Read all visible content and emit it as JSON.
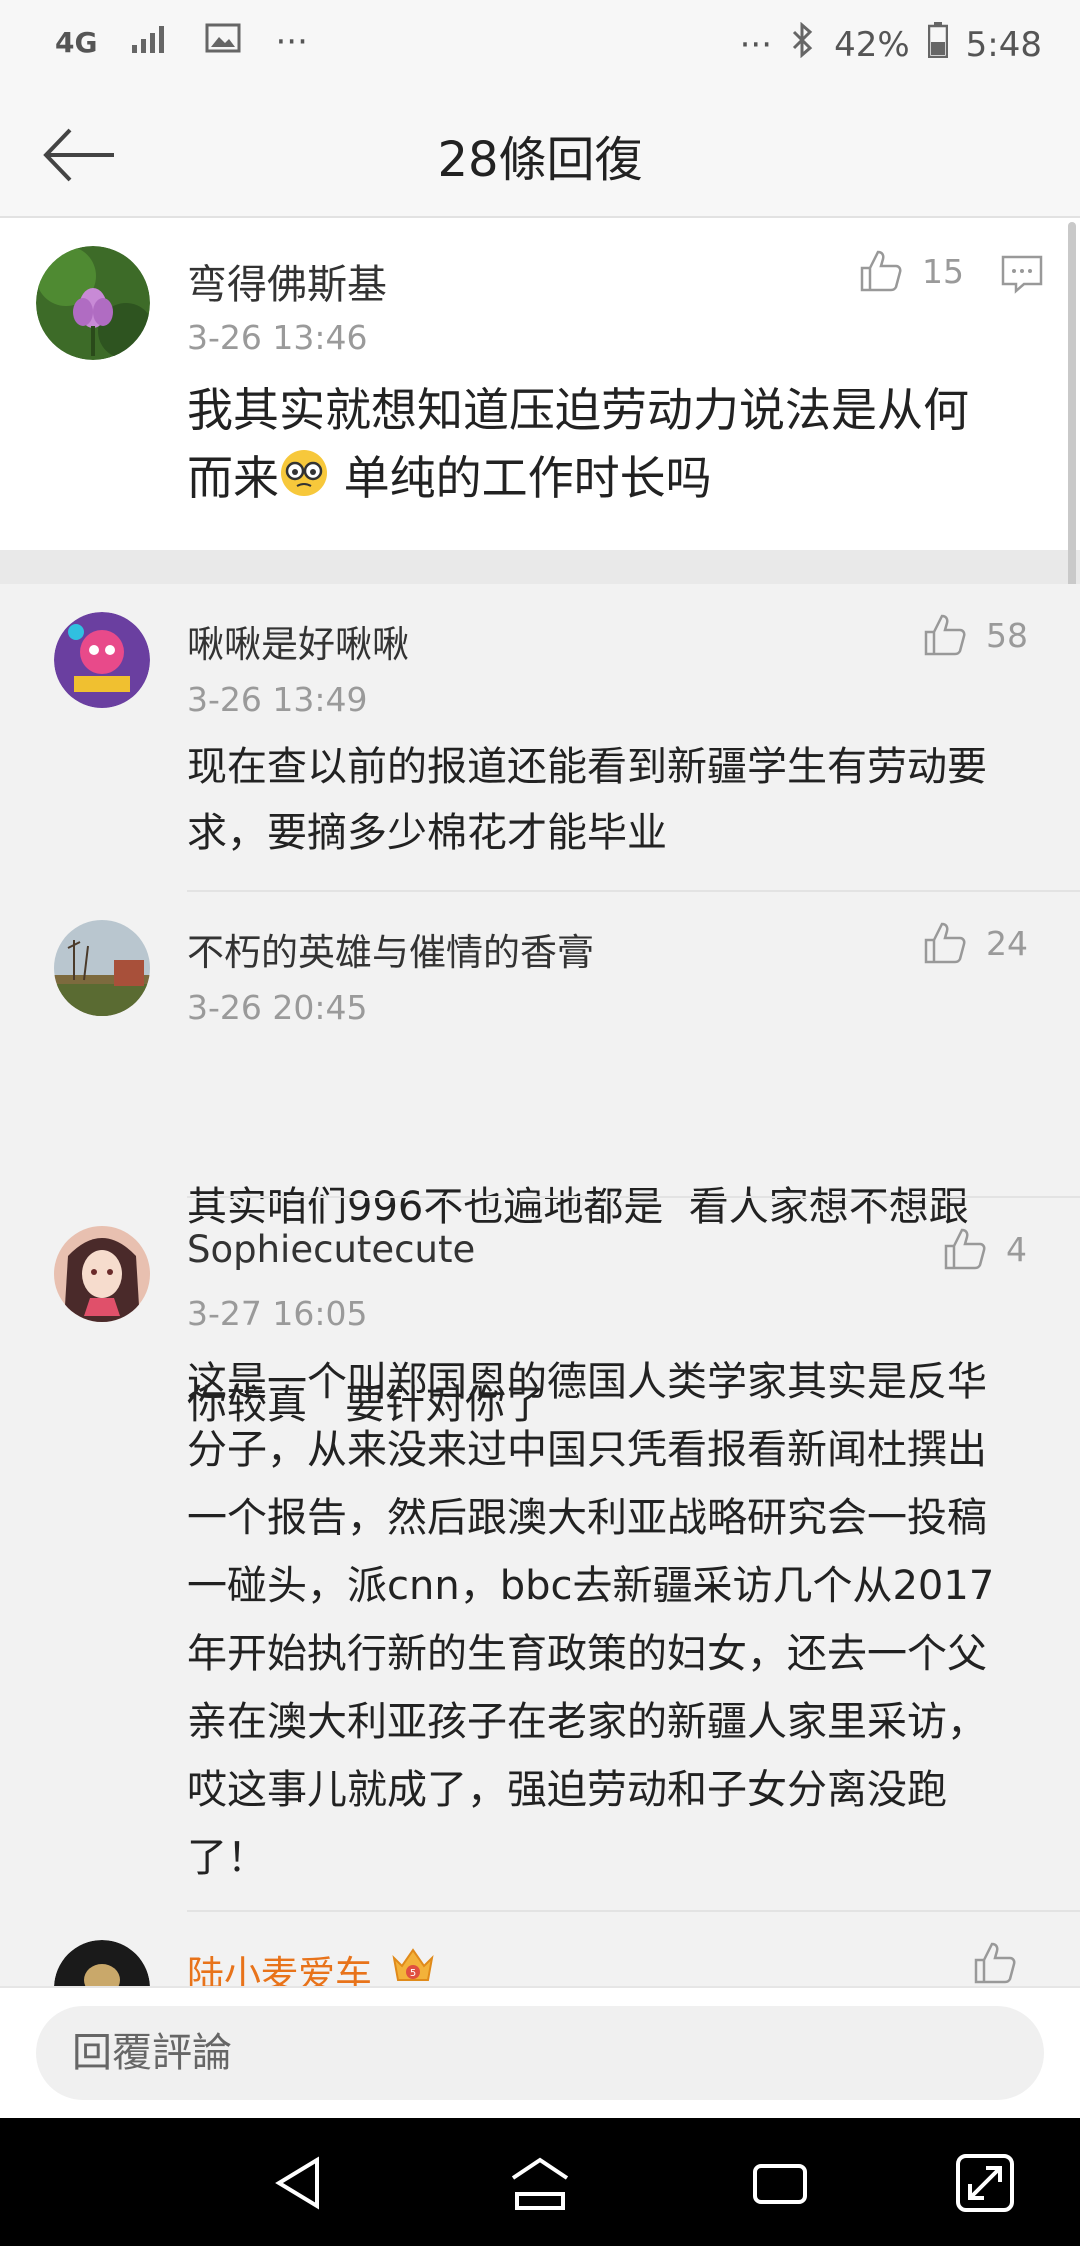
{
  "status_bar": {
    "network": "4G",
    "more_left": "···",
    "more_right": "···",
    "battery": "42%",
    "time": "5:48"
  },
  "header": {
    "title": "28條回復"
  },
  "original_comment": {
    "username": "弯得佛斯基",
    "time": "3-26 13:46",
    "likes": "15",
    "text_line1": "我其实就想知道压迫劳动力说法是从何",
    "text_line2_a": "而来",
    "text_line2_b": " 单纯的工作时长吗"
  },
  "replies": [
    {
      "username": "啾啾是好啾啾",
      "time": "3-26 13:49",
      "likes": "58",
      "lines": [
        "现在查以前的报道还能看到新疆学生有劳动要",
        "求，要摘多少棉花才能毕业"
      ]
    },
    {
      "username": "不朽的英雄与催情的香膏",
      "time": "3-26 20:45",
      "likes": "24",
      "lines": [
        "其实咱们996不也遍地都是  看人家想不想跟",
        "你较真   要针对你了"
      ]
    },
    {
      "username": "Sophiecutecute",
      "time": "3-27 16:05",
      "likes": "4",
      "lines": [
        "这是一个叫郑国恩的德国人类学家其实是反华",
        "分子，从来没来过中国只凭看报看新闻杜撰出",
        "一个报告，然后跟澳大利亚战略研究会一投稿",
        "一碰头，派cnn，bbc去新疆采访几个从2017",
        "年开始执行新的生育政策的妇女，还去一个父",
        "亲在澳大利亚孩子在老家的新疆人家里采访，",
        "哎这事儿就成了，强迫劳动和子女分离没跑",
        "了！"
      ]
    },
    {
      "username": "陆小麦爱车",
      "username_color": "#e8731a",
      "badge_text": "5"
    }
  ],
  "input_bar": {
    "placeholder": "回覆評論"
  },
  "colors": {
    "accent_orange": "#e8731a",
    "muted": "#9a9a9a"
  }
}
